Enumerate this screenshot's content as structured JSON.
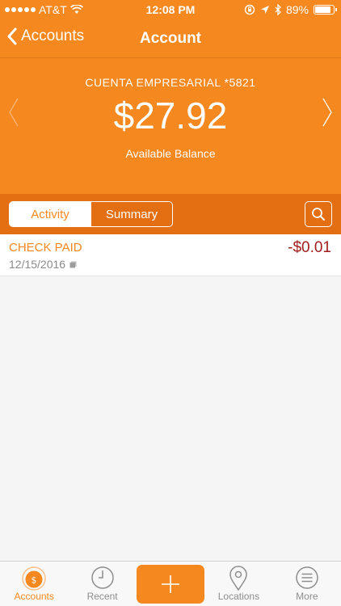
{
  "status_bar": {
    "carrier": "AT&T",
    "time": "12:08 PM",
    "battery": "89%",
    "battery_level": 0.89
  },
  "nav": {
    "back_label": "Accounts",
    "title": "Account"
  },
  "account": {
    "name": "CUENTA EMPRESARIAL *5821",
    "balance": "$27.92",
    "balance_label": "Available Balance"
  },
  "segments": {
    "activity": "Activity",
    "summary": "Summary"
  },
  "transactions": [
    {
      "description": "CHECK PAID",
      "date": "12/15/2016",
      "amount": "-$0.01"
    }
  ],
  "tabs": {
    "accounts": "Accounts",
    "recent": "Recent",
    "locations": "Locations",
    "more": "More"
  },
  "colors": {
    "brand_orange": "#f5881f",
    "toolbar_orange": "#e36f12",
    "negative_amount": "#a11d1d"
  }
}
